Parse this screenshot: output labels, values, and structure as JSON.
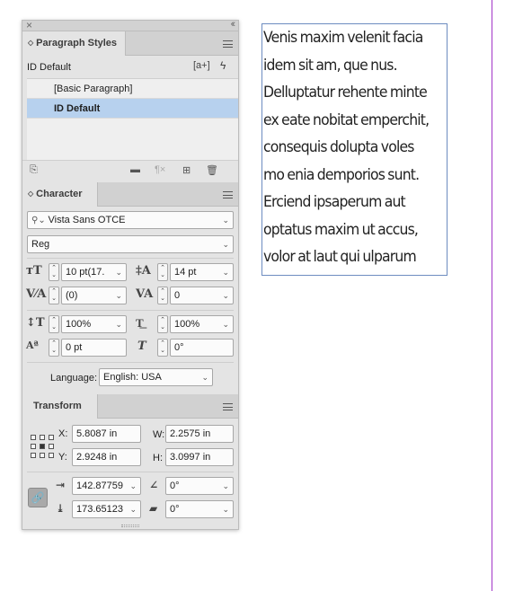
{
  "paragraph_styles": {
    "title": "Paragraph Styles",
    "current": "ID Default",
    "new_style_label": "[a+]",
    "items": [
      {
        "label": "[Basic Paragraph]",
        "selected": false
      },
      {
        "label": "ID Default",
        "selected": true
      }
    ]
  },
  "character": {
    "title": "Character",
    "font_family": "Vista Sans OTCE",
    "font_style": "Reg",
    "font_size": "10 pt(17.",
    "leading": "14 pt",
    "kerning": "(0)",
    "tracking": "0",
    "vertical_scale": "100%",
    "horizontal_scale": "100%",
    "baseline_shift": "0 pt",
    "skew": "0°",
    "language_label": "Language:",
    "language_value": "English: USA"
  },
  "transform": {
    "title": "Transform",
    "x_label": "X:",
    "x_value": "5.8087 in",
    "y_label": "Y:",
    "y_value": "2.9248 in",
    "w_label": "W:",
    "w_value": "2.2575 in",
    "h_label": "H:",
    "h_value": "3.0997 in",
    "scale_x": "142.87759",
    "scale_y": "173.65123",
    "rotate": "0°",
    "shear": "0°"
  },
  "text_frame": {
    "lines": [
      "Venis maxim velenit facia",
      "idem sit am, que nus.",
      "Delluptatur rehente minte",
      "ex eate nobitat emperchit,",
      "consequis dolupta voles",
      "mo enia demporios sunt.",
      "Erciend ipsaperum aut",
      "optatus maxim ut accus,",
      "volor at laut qui ulparum"
    ]
  },
  "colors": {
    "selection_blue": "#b7d1ee",
    "frame_border": "#6d8cc0",
    "page_edge_purple": "#a235c7"
  }
}
